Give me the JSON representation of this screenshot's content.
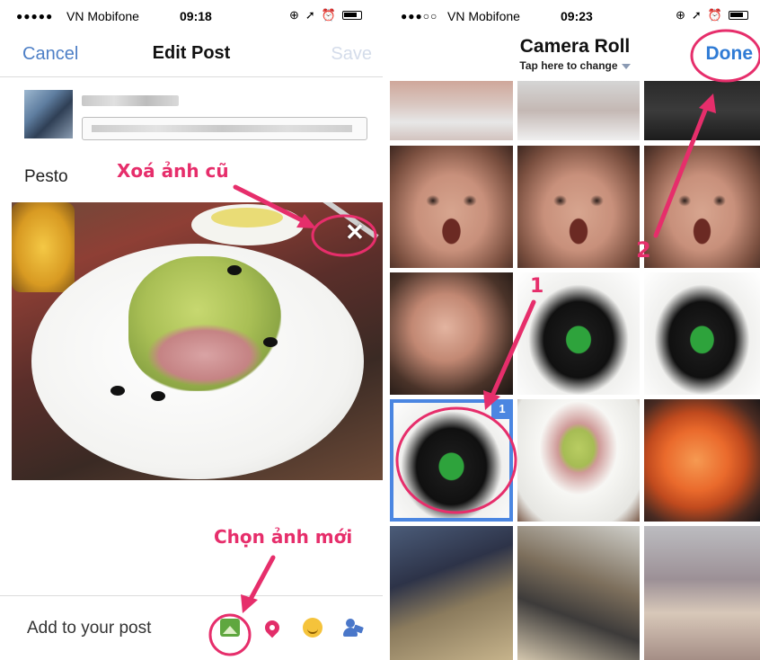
{
  "left": {
    "status": {
      "signal": "●●●●●",
      "carrier": "VN Mobifone",
      "wifi": "wifi-icon",
      "time": "09:18"
    },
    "nav": {
      "cancel": "Cancel",
      "title": "Edit Post",
      "save": "Save"
    },
    "post_text": "Pesto",
    "bottom": {
      "add_label": "Add to your post",
      "tools": [
        "photo-icon",
        "location-pin-icon",
        "feeling-smiley-icon",
        "tag-people-icon"
      ]
    }
  },
  "right": {
    "status": {
      "signal": "●●●○○",
      "carrier": "VN Mobifone",
      "time": "09:23"
    },
    "nav": {
      "title": "Camera Roll",
      "subtitle": "Tap here to change",
      "done": "Done"
    },
    "selected_badge": "1"
  },
  "annotations": {
    "remove_old": "Xoá ảnh cũ",
    "choose_new": "Chọn ảnh mới",
    "step1": "1",
    "step2": "2",
    "color": "#e62e6b"
  },
  "colors": {
    "ios_blue": "#4d7fc6",
    "selection_blue": "#4b86e1",
    "disabled_save": "#d4dcea"
  }
}
